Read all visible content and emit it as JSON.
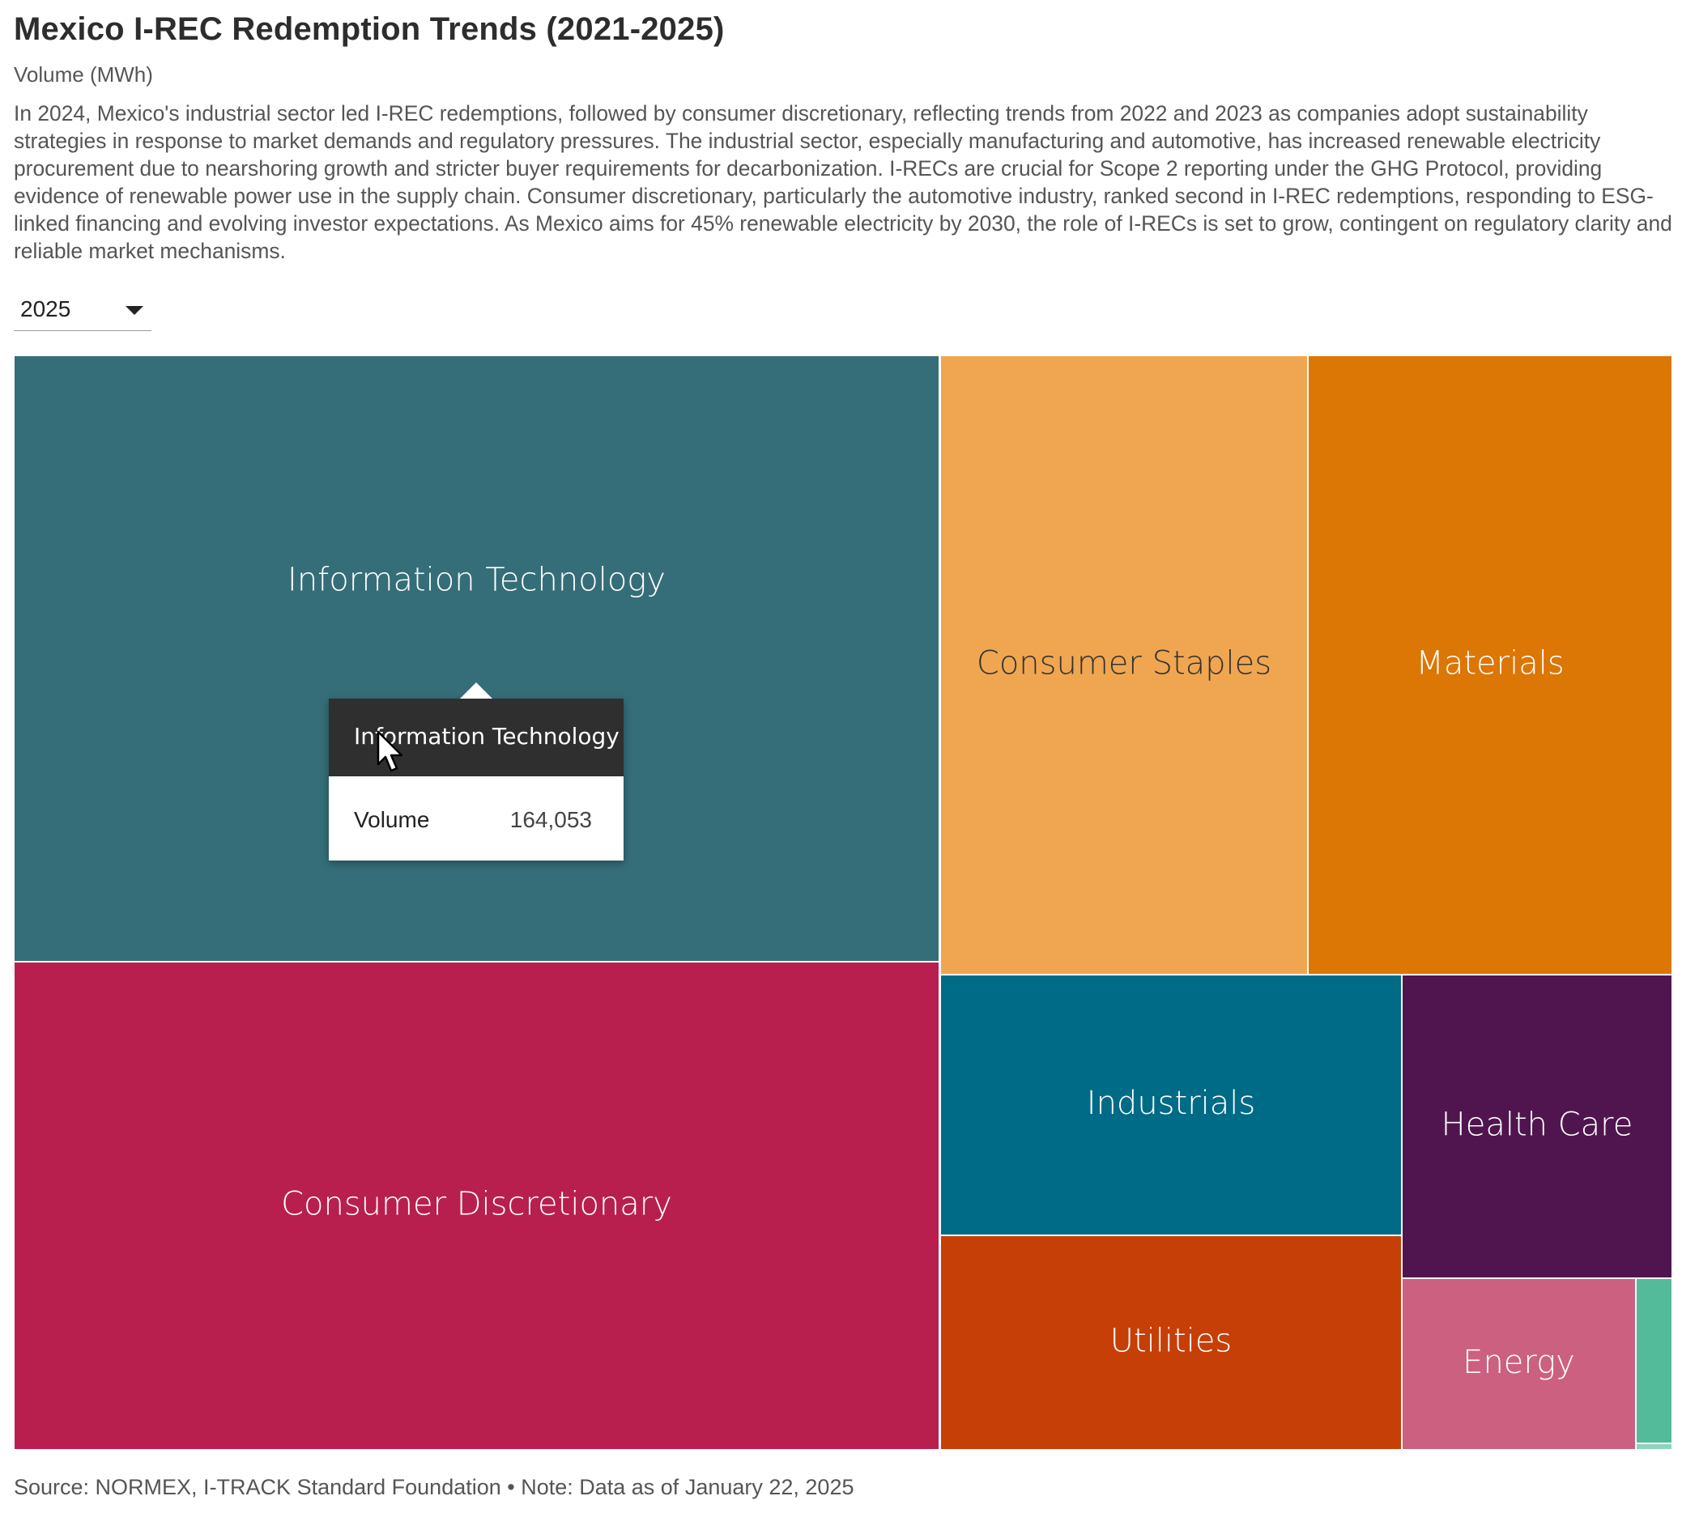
{
  "header": {
    "title": "Mexico I-REC Redemption Trends (2021-2025)",
    "subtitle": "Volume (MWh)",
    "description": "In 2024, Mexico's industrial sector led I-REC redemptions, followed by consumer discretionary, reflecting trends from 2022 and 2023 as companies adopt sustainability strategies in response to market demands and regulatory pressures. The industrial sector, especially manufacturing and automotive, has increased renewable electricity procurement due to nearshoring growth and stricter buyer requirements for decarbonization. I-RECs are crucial for Scope 2 reporting under the GHG Protocol, providing evidence of renewable power use in the supply chain. Consumer discretionary, particularly the automotive industry, ranked second in I-REC redemptions, responding to ESG-linked financing and evolving investor expectations. As Mexico aims for 45% renewable electricity by 2030, the role of I-RECs is set to grow, contingent on regulatory clarity and reliable market mechanisms."
  },
  "year_select": {
    "selected": "2025"
  },
  "chart_data": {
    "type": "treemap",
    "value_label": "Volume",
    "unit": "MWh",
    "nodes": [
      {
        "name": "Information Technology",
        "value": 164053,
        "color": "#356e79",
        "label_color": "#ffffff"
      },
      {
        "name": "Consumer Discretionary",
        "value": 132000,
        "color": "#b81f4e",
        "label_color": "#ffffff"
      },
      {
        "name": "Consumer Staples",
        "value": 66000,
        "color": "#f0a650",
        "label_color": "#333333"
      },
      {
        "name": "Materials",
        "value": 65000,
        "color": "#dc7605",
        "label_color": "#ffffff"
      },
      {
        "name": "Industrials",
        "value": 35000,
        "color": "#006b87",
        "label_color": "#ffffff"
      },
      {
        "name": "Utilities",
        "value": 29000,
        "color": "#c63f07",
        "label_color": "#ffffff"
      },
      {
        "name": "Health Care",
        "value": 22000,
        "color": "#50154f",
        "label_color": "#ffffff"
      },
      {
        "name": "Energy",
        "value": 11000,
        "color": "#cc6080",
        "label_color": "#ffffff"
      },
      {
        "name": "",
        "value": 1600,
        "color": "#54bb9a",
        "label_color": "#ffffff"
      },
      {
        "name": "",
        "value": 150,
        "color": "#8fd3bb",
        "label_color": "#ffffff"
      }
    ]
  },
  "tooltip": {
    "title": "Information Technology",
    "label": "Volume",
    "value": "164,053"
  },
  "footer": {
    "source": "Source: NORMEX, I-TRACK Standard Foundation • Note: Data as of January 22, 2025"
  }
}
